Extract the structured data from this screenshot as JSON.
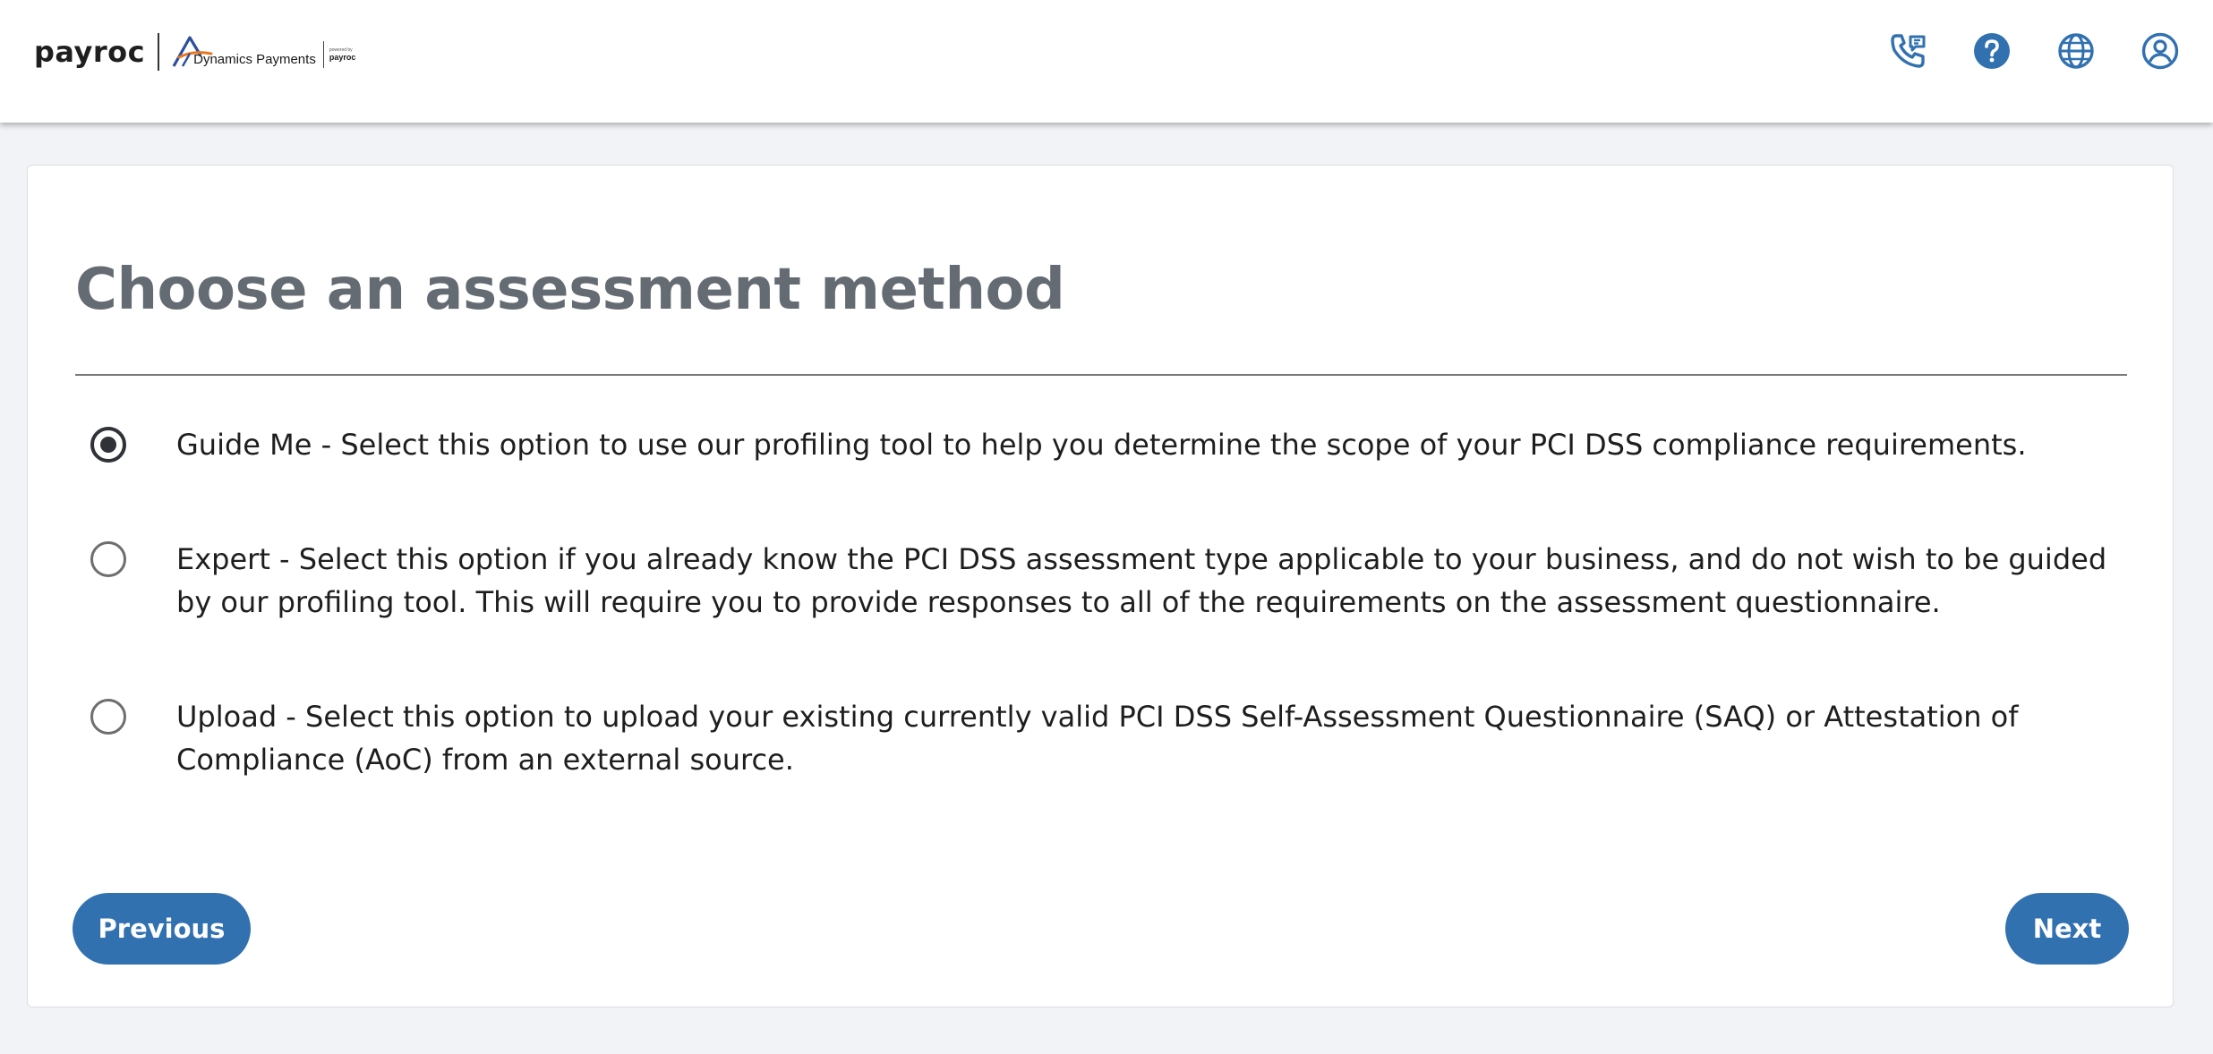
{
  "header": {
    "brand": "payroc",
    "partner_name": "Dynamics Payments",
    "partner_tagline": "powered by",
    "partner_sub_brand": "payroc",
    "icons": [
      "contact-phone-icon",
      "help-icon",
      "language-globe-icon",
      "user-account-icon"
    ],
    "accent_color": "#3271b0"
  },
  "page": {
    "title": "Choose an assessment method"
  },
  "options": [
    {
      "label": "Guide Me - Select this option to use our profiling tool to help you determine the scope of your PCI DSS compliance requirements.",
      "selected": true
    },
    {
      "label": "Expert - Select this option if you already know the PCI DSS assessment type applicable to your business, and do not wish to be guided by our profiling tool. This will require you to provide responses to all of the requirements on the assessment questionnaire.",
      "selected": false
    },
    {
      "label": "Upload - Select this option to upload your existing currently valid PCI DSS Self-Assessment Questionnaire (SAQ) or Attestation of Compliance (AoC) from an external source.",
      "selected": false
    }
  ],
  "actions": {
    "previous_label": "Previous",
    "next_label": "Next"
  }
}
